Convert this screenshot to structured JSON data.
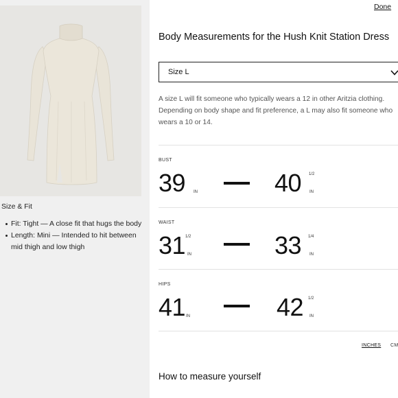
{
  "left_panel": {
    "fit_title": "Size & Fit",
    "fit_items": [
      "Fit: Tight — A close fit that hugs the body",
      "Length: Mini — Intended to hit between mid thigh and low thigh"
    ]
  },
  "header": {
    "done_label": "Done"
  },
  "modal": {
    "title": "Body Measurements for the Hush Knit Station Dress",
    "size_select": {
      "value": "Size L",
      "icon": "chevron-down-icon"
    },
    "description": "A size L will fit someone who typically wears a 12 in other Aritzia clothing. Depending on body shape and fit preference, a L may also fit someone who wears a 10 or 14."
  },
  "measurements": [
    {
      "label": "BUST",
      "min": "39",
      "min_frac": "",
      "min_unit": "IN",
      "max": "40",
      "max_frac": "1/2",
      "max_unit": "IN"
    },
    {
      "label": "WAIST",
      "min": "31",
      "min_frac": "1/2",
      "min_unit": "IN",
      "max": "33",
      "max_frac": "1/4",
      "max_unit": "IN"
    },
    {
      "label": "HIPS",
      "min": "41",
      "min_frac": "",
      "min_unit": "IN",
      "max": "42",
      "max_frac": "1/2",
      "max_unit": "IN"
    }
  ],
  "units": {
    "inches": "INCHES",
    "cm": "CM"
  },
  "howto": {
    "title": "How to measure yourself"
  },
  "colors": {
    "left_bg": "#f0f0f0",
    "text": "#111111",
    "dress": "#e9e4d8"
  }
}
